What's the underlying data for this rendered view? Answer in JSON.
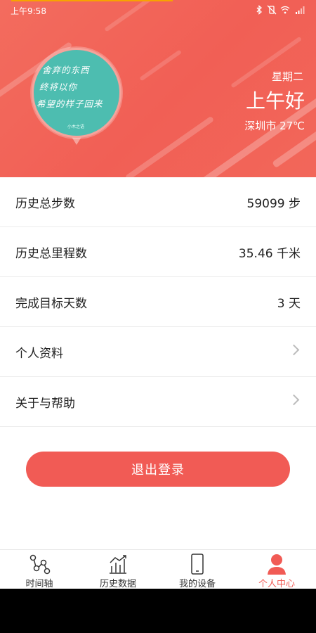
{
  "status_bar": {
    "time": "上午9:58"
  },
  "header": {
    "avatar_lines": [
      "舍弃的东西",
      "终将以你",
      "希望的样子回来"
    ],
    "avatar_signature": "小木之语",
    "weekday": "星期二",
    "greeting": "上午好",
    "weather": "深圳市 27℃"
  },
  "stats": [
    {
      "label": "历史总步数",
      "value": "59099 步"
    },
    {
      "label": "历史总里程数",
      "value": "35.46 千米"
    },
    {
      "label": "完成目标天数",
      "value": "3 天"
    }
  ],
  "menu": [
    {
      "label": "个人资料"
    },
    {
      "label": "关于与帮助"
    }
  ],
  "logout_label": "退出登录",
  "bottom_nav": [
    {
      "label": "时间轴",
      "icon": "timeline-icon"
    },
    {
      "label": "历史数据",
      "icon": "chart-icon"
    },
    {
      "label": "我的设备",
      "icon": "phone-icon"
    },
    {
      "label": "个人中心",
      "icon": "person-icon",
      "active": true
    }
  ],
  "colors": {
    "accent": "#f15b55",
    "header_gradient": "#f36c5e"
  }
}
